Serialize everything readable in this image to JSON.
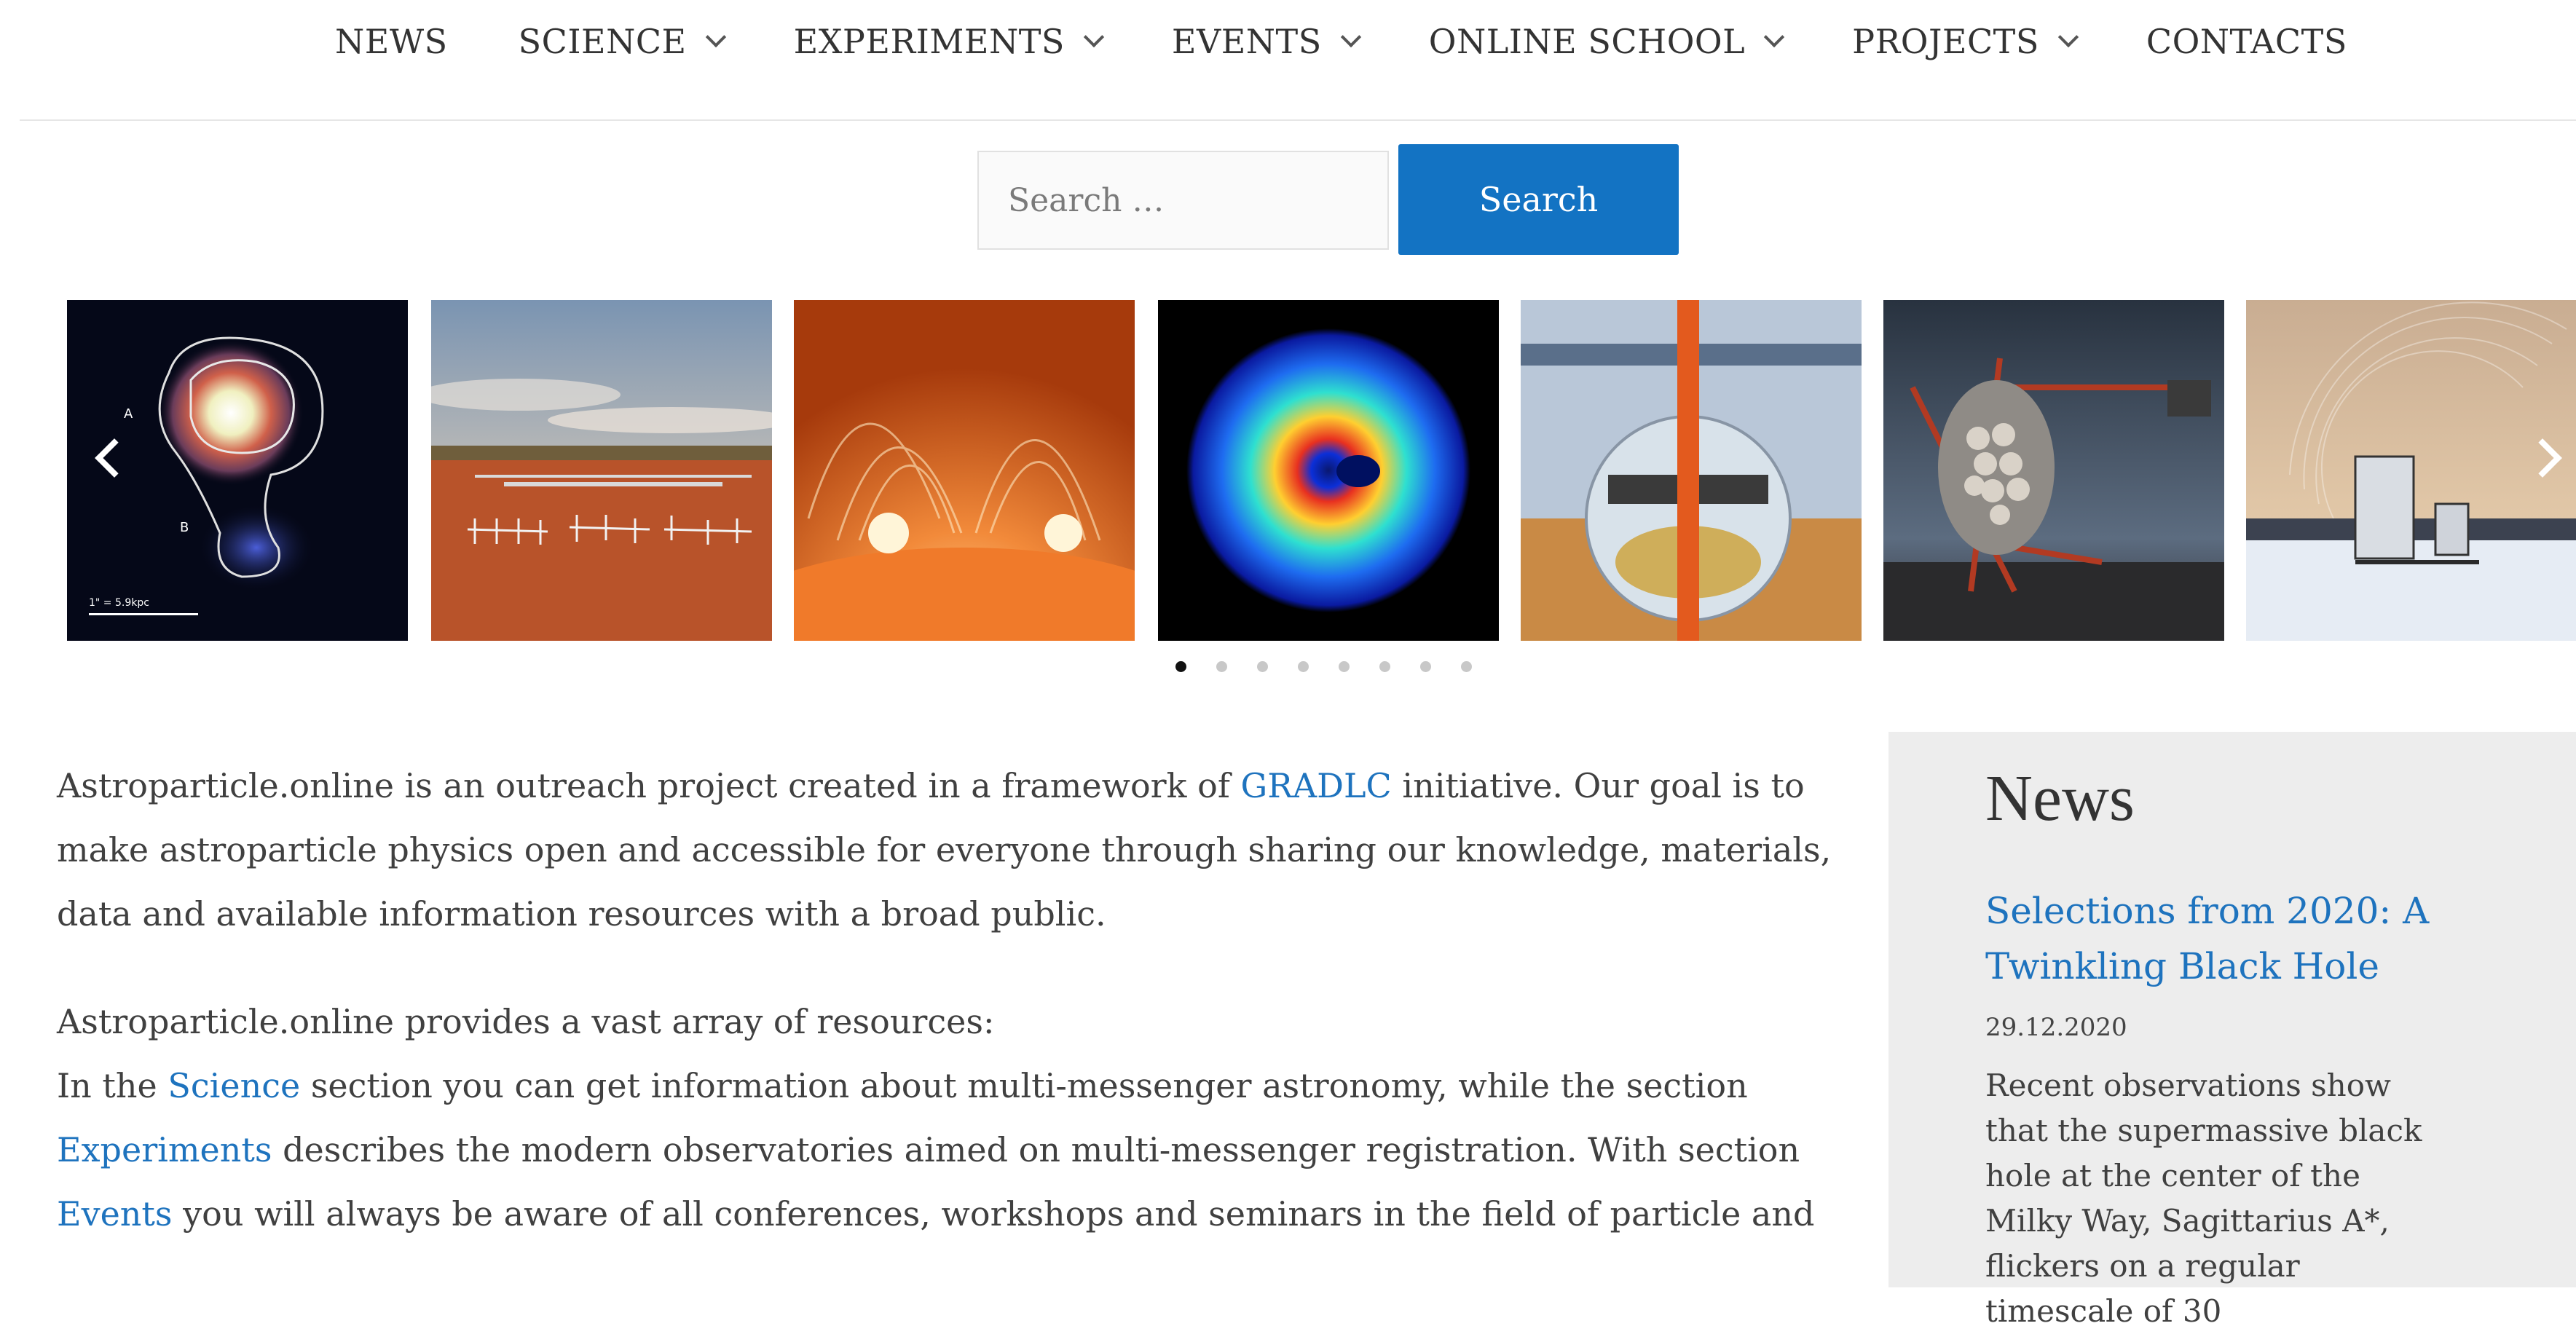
{
  "nav": {
    "items": [
      {
        "label": "NEWS",
        "dropdown": false
      },
      {
        "label": "SCIENCE",
        "dropdown": true
      },
      {
        "label": "EXPERIMENTS",
        "dropdown": true
      },
      {
        "label": "EVENTS",
        "dropdown": true
      },
      {
        "label": "ONLINE SCHOOL",
        "dropdown": true
      },
      {
        "label": "PROJECTS",
        "dropdown": true
      },
      {
        "label": "CONTACTS",
        "dropdown": false
      }
    ]
  },
  "search": {
    "placeholder": "Search …",
    "button_label": "Search"
  },
  "slider": {
    "scale_label": "1\" = 5.9kpc",
    "marker_a": "A",
    "marker_b": "B",
    "slide_count": 8,
    "active_index": 0
  },
  "main": {
    "p1": {
      "before": "Astroparticle.online is an outreach project created in a framework of ",
      "link": "GRADLC",
      "after": " initiative. Our goal is to make astroparticle physics open and accessible for everyone through sharing our knowledge, materials, data and available information resources with a broad public."
    },
    "p2_intro": "Astroparticle.online provides a vast array of resources:",
    "p2": {
      "t1": "In the ",
      "science": "Science",
      "t2": " section you can get information about multi-messenger astronomy, while the section ",
      "experiments": "Experiments",
      "t3": " describes the modern observatories aimed on multi-messenger registration. With section ",
      "events": "Events",
      "t4": " you will always be aware of all conferences, workshops and seminars in the field of particle and"
    }
  },
  "sidebar": {
    "title": "News",
    "article": {
      "title": "Selections from 2020: A Twinkling Black Hole",
      "date": "29.12.2020",
      "excerpt": "Recent observations show that the supermassive black hole at the center of the Milky Way, Sagittarius A*, flickers on a regular timescale of 30"
    }
  },
  "colors": {
    "accent": "#1373c3",
    "link": "#1e73be",
    "sidebar_bg": "#ededed"
  }
}
